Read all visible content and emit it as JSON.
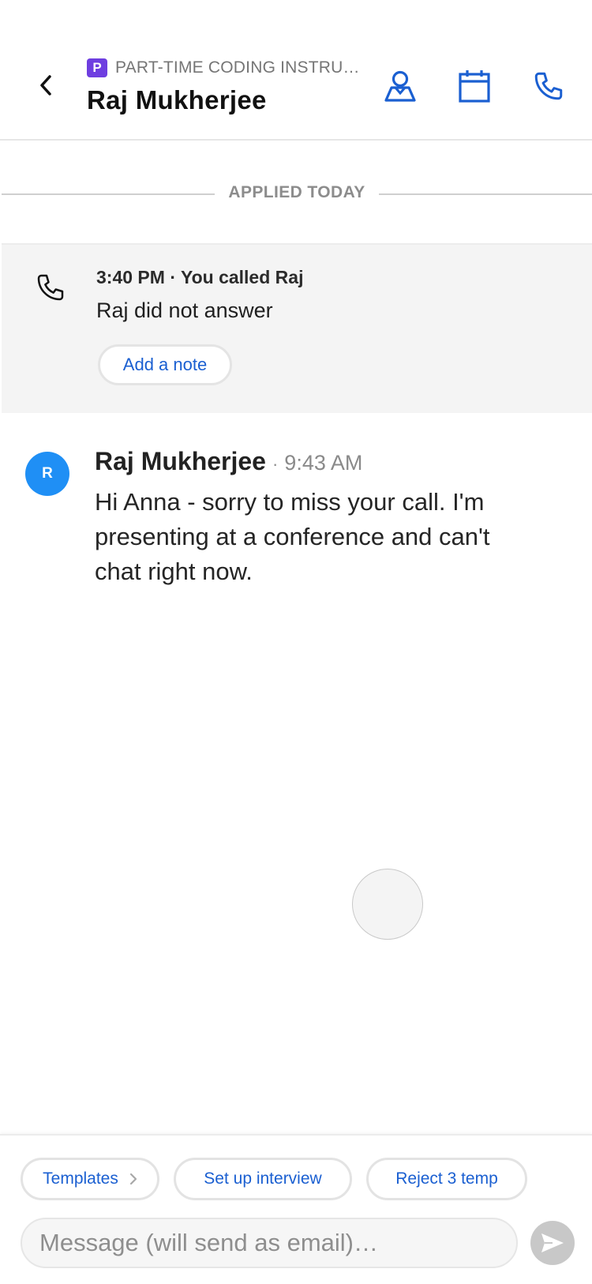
{
  "header": {
    "job_badge": "P",
    "job_title": "PART-TIME CODING INSTRU…",
    "candidate_name": "Raj Mukherjee",
    "icons": [
      "back-chevron-icon",
      "profile-icon",
      "calendar-icon",
      "phone-icon"
    ],
    "accent_color": "#1a5fd1"
  },
  "divider": {
    "label": "APPLIED TODAY"
  },
  "call": {
    "meta": "3:40 PM · You called Raj",
    "status": "Raj did not answer",
    "add_note_label": "Add a note"
  },
  "message": {
    "avatar_initial": "R",
    "sender": "Raj Mukherjee",
    "separator": "·",
    "time": "9:43 AM",
    "body": "Hi Anna - sorry to miss your call. I'm presenting at a conference and can't chat right now."
  },
  "composer": {
    "chips": [
      "Templates",
      "Set up interview",
      "Reject 3 temp"
    ],
    "placeholder": "Message (will send as email)…"
  }
}
